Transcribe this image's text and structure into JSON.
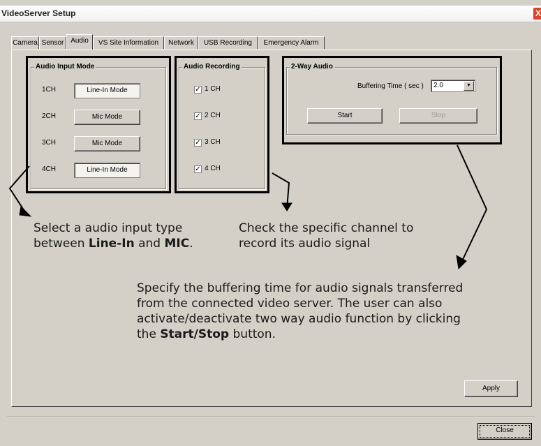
{
  "window": {
    "title": "VideoServer Setup",
    "close_glyph": "X"
  },
  "tabs": [
    {
      "label": "Camera",
      "active": false
    },
    {
      "label": "Sensor",
      "active": false
    },
    {
      "label": "Audio",
      "active": true
    },
    {
      "label": "VS Site Information",
      "active": false
    },
    {
      "label": "Network",
      "active": false
    },
    {
      "label": "USB Recording",
      "active": false
    },
    {
      "label": "Emergency Alarm",
      "active": false
    }
  ],
  "audio_input": {
    "title": "Audio Input Mode",
    "channels": [
      {
        "label": "1CH",
        "mode": "Line-In Mode"
      },
      {
        "label": "2CH",
        "mode": "Mic Mode"
      },
      {
        "label": "3CH",
        "mode": "Mic Mode"
      },
      {
        "label": "4CH",
        "mode": "Line-In Mode"
      }
    ]
  },
  "audio_recording": {
    "title": "Audio Recording",
    "channels": [
      {
        "label": "1 CH",
        "checked": true
      },
      {
        "label": "2 CH",
        "checked": true
      },
      {
        "label": "3 CH",
        "checked": true
      },
      {
        "label": "4 CH",
        "checked": true
      }
    ],
    "check_glyph": "✓"
  },
  "two_way_audio": {
    "title": "2-Way Audio",
    "buffering_label": "Buffering Time ( sec )",
    "buffering_value": "2.0",
    "dropdown_arrow": "▼",
    "start_label": "Start",
    "stop_label": "Stop"
  },
  "annotations": {
    "input_line1": "Select a audio input type",
    "input_line2_pre": "between ",
    "input_line2_b1": "Line-In",
    "input_line2_mid": " and ",
    "input_line2_b2": "MIC",
    "input_line2_end": ".",
    "record_line1": "Check the specific channel to",
    "record_line2": "record its audio signal",
    "buffer_line1": "Specify the buffering time for audio signals transferred",
    "buffer_line2": "from the connected video server. The user can also",
    "buffer_line3": "activate/deactivate two way audio function by clicking",
    "buffer_line4_pre": "the ",
    "buffer_line4_b": "Start/Stop",
    "buffer_line4_end": " button."
  },
  "footer": {
    "apply_label": "Apply",
    "close_label": "Close"
  },
  "icons": {
    "close": "close-icon",
    "dropdown": "chevron-down-icon",
    "checkbox": "check-icon"
  }
}
